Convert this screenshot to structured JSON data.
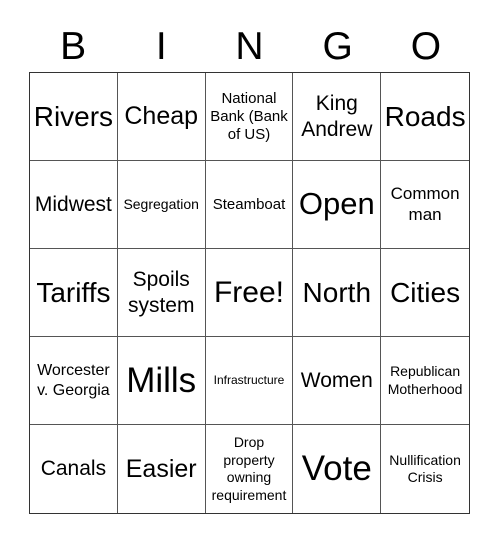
{
  "header": {
    "letters": [
      "B",
      "I",
      "N",
      "G",
      "O"
    ]
  },
  "cells": [
    {
      "text": "Rivers"
    },
    {
      "text": "Cheap"
    },
    {
      "text": "National Bank (Bank of US)"
    },
    {
      "text": "King Andrew"
    },
    {
      "text": "Roads"
    },
    {
      "text": "Midwest"
    },
    {
      "text": "Segregation"
    },
    {
      "text": "Steamboat"
    },
    {
      "text": "Open"
    },
    {
      "text": "Common man"
    },
    {
      "text": "Tariffs"
    },
    {
      "text": "Spoils system"
    },
    {
      "text": "Free!"
    },
    {
      "text": "North"
    },
    {
      "text": "Cities"
    },
    {
      "text": "Worcester v. Georgia"
    },
    {
      "text": "Mills"
    },
    {
      "text": "Infrastructure"
    },
    {
      "text": "Women"
    },
    {
      "text": "Republican Motherhood"
    },
    {
      "text": "Canals"
    },
    {
      "text": "Easier"
    },
    {
      "text": "Drop property owning requirement"
    },
    {
      "text": "Vote"
    },
    {
      "text": "Nullification Crisis"
    }
  ]
}
